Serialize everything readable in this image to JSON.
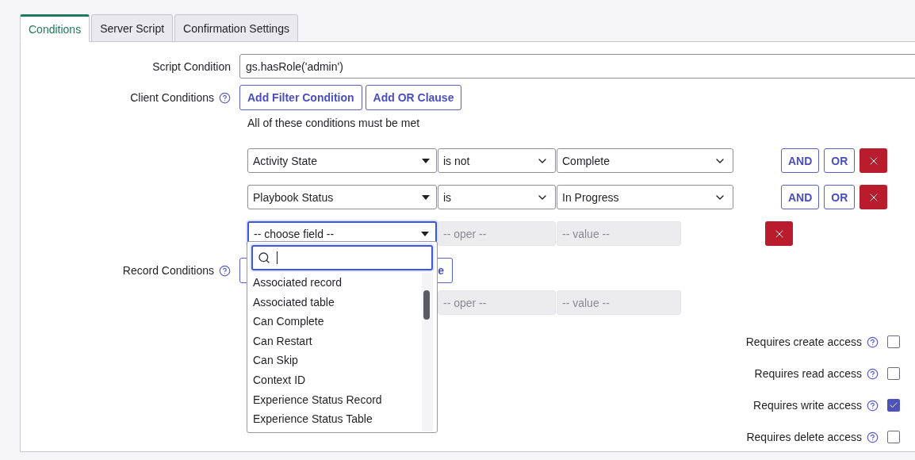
{
  "tabs": [
    {
      "label": "Conditions",
      "selected": true
    },
    {
      "label": "Server Script",
      "selected": false
    },
    {
      "label": "Confirmation Settings",
      "selected": false
    }
  ],
  "script_condition": {
    "label": "Script Condition",
    "value": "gs.hasRole('admin')"
  },
  "client_conditions": {
    "label": "Client Conditions",
    "buttons": [
      "Add Filter Condition",
      "Add OR Clause"
    ],
    "note": "All of these conditions must be met",
    "rows": [
      {
        "kind": "filled",
        "field": "Activity State",
        "oper": "is not",
        "value": "Complete",
        "actions": [
          "AND",
          "OR"
        ],
        "focused": false
      },
      {
        "kind": "filled",
        "field": "Playbook Status",
        "oper": "is",
        "value": "In Progress",
        "actions": [
          "AND",
          "OR"
        ],
        "focused": false
      },
      {
        "kind": "empty",
        "field": "-- choose field --",
        "oper": "-- oper --",
        "value": "-- value --",
        "focused": true
      }
    ]
  },
  "record_conditions": {
    "label": "Record Conditions",
    "button_fragment": "e",
    "oper": "-- oper --",
    "value": "-- value --"
  },
  "field_dropdown": {
    "items": [
      "Associated record",
      "Associated table",
      "Can Complete",
      "Can Restart",
      "Can Skip",
      "Context ID",
      "Experience Status Record",
      "Experience Status Table"
    ]
  },
  "access": [
    {
      "label": "Requires create access",
      "checked": false
    },
    {
      "label": "Requires read access",
      "checked": false
    },
    {
      "label": "Requires write access",
      "checked": true
    },
    {
      "label": "Requires delete access",
      "checked": false
    }
  ]
}
